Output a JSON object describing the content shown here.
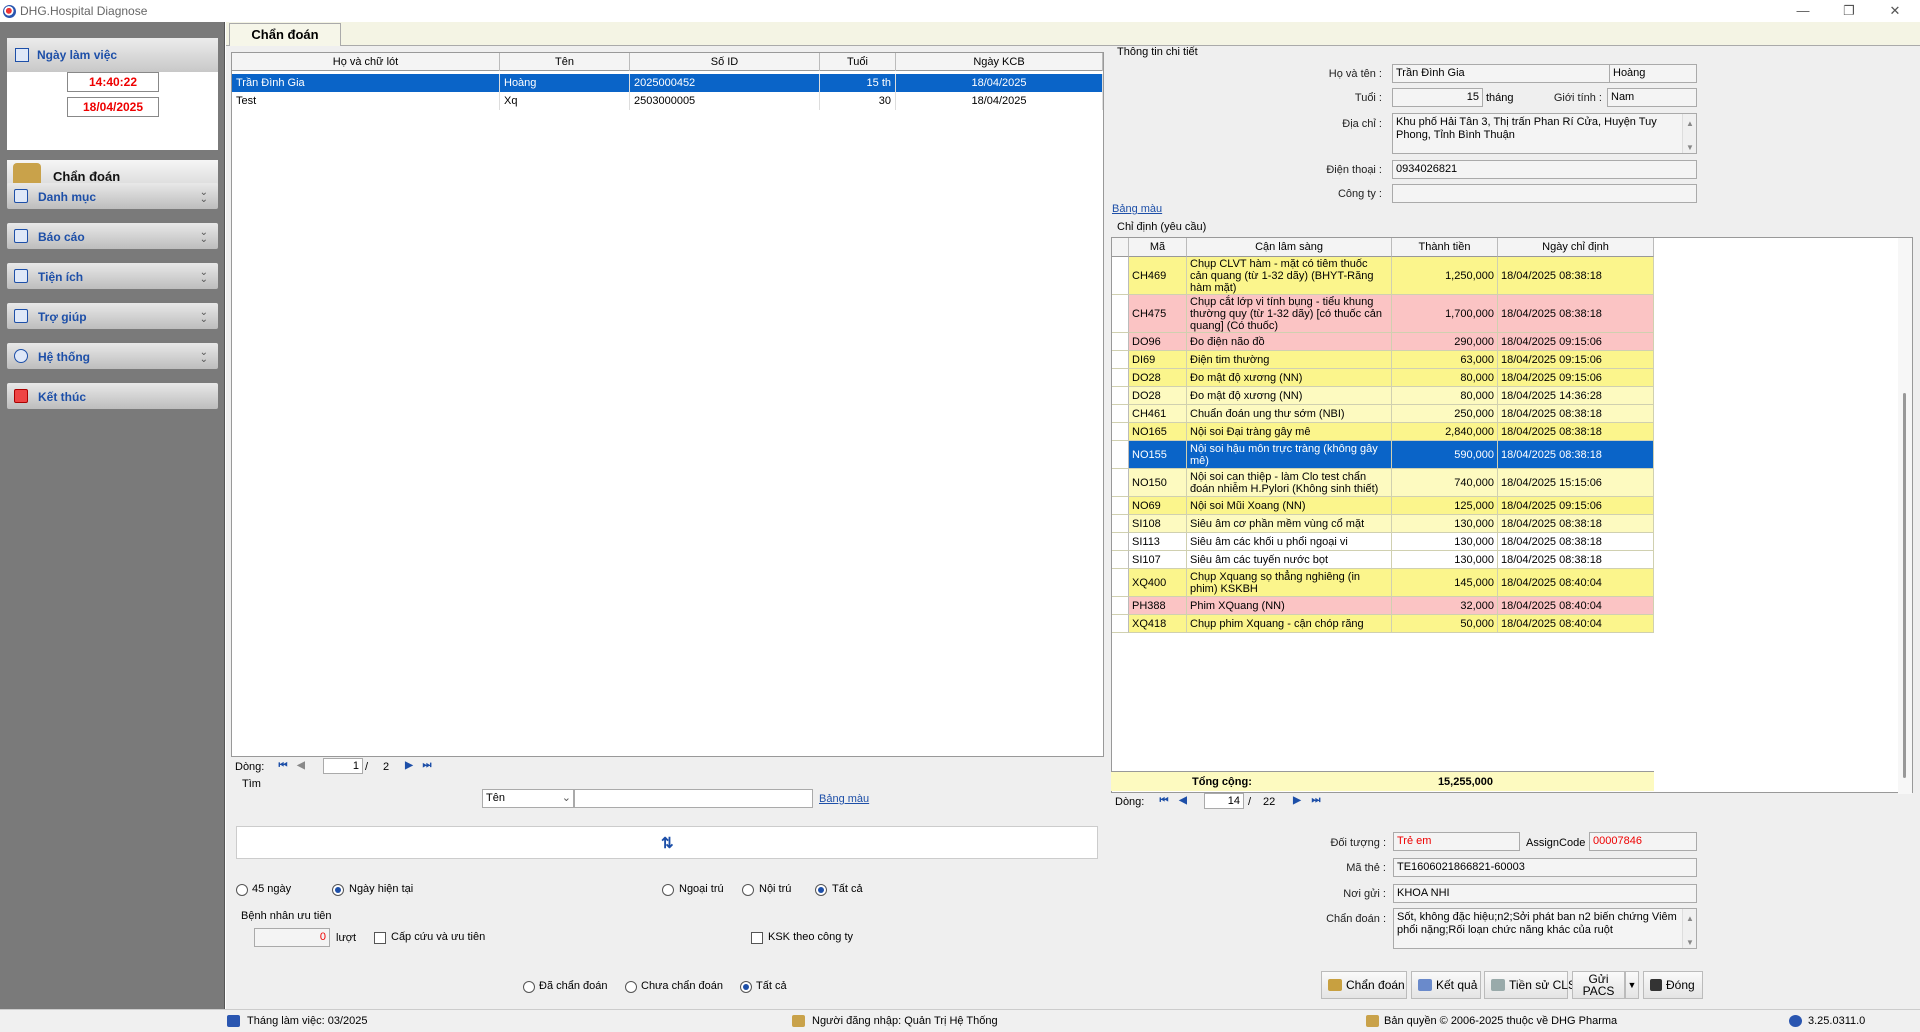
{
  "window": {
    "title": "DHG.Hospital Diagnose"
  },
  "sidebar": {
    "header": "Ngày làm việc",
    "time": "14:40:22",
    "date": "18/04/2025",
    "active": "Chẩn đoán",
    "items": [
      "Danh mục",
      "Báo cáo",
      "Tiện ích",
      "Trợ giúp",
      "Hệ thống",
      "Kết thúc"
    ]
  },
  "tab": "Chẩn đoán",
  "patients": {
    "columns": [
      "Họ và chữ lót",
      "Tên",
      "Số ID",
      "Tuổi",
      "Ngày KCB"
    ],
    "rows": [
      [
        "Trần Đình Gia",
        "Hoàng",
        "2025000452",
        "15 th",
        "18/04/2025"
      ],
      [
        "Test",
        "Xq",
        "2503000005",
        "30",
        "18/04/2025"
      ]
    ],
    "pager": {
      "label": "Dòng:",
      "current": "1",
      "total": "2"
    }
  },
  "search": {
    "label": "Tìm",
    "field": "Tên",
    "value": "",
    "color_link": "Bảng màu"
  },
  "filters": {
    "days": "45 ngày",
    "today": "Ngày hiện tại",
    "outpatient": "Ngoại trú",
    "inpatient": "Nội trú",
    "all": "Tất cả",
    "priority_group": "Bệnh nhân ưu tiên",
    "priority_count": "0",
    "priority_unit": "lượt",
    "emergency": "Cấp cứu và ưu tiên",
    "ksk": "KSK theo công ty",
    "diagnosed": "Đã chẩn đoán",
    "not_diagnosed": "Chưa chẩn đoán",
    "all2": "Tất cả"
  },
  "detail": {
    "group": "Thông tin chi tiết",
    "name_label": "Họ và tên :",
    "last": "Trần Đình Gia",
    "first": "Hoàng",
    "age_label": "Tuổi :",
    "age": "15",
    "age_unit": "tháng",
    "gender_label": "Giới tính :",
    "gender": "Nam",
    "addr_label": "Địa chỉ :",
    "address": "Khu phố Hải Tân 3, Thị trấn Phan Rí Cửa, Huyện Tuy Phong, Tỉnh Bình Thuận",
    "phone_label": "Điện thoại :",
    "phone": "0934026821",
    "company_label": "Công ty :",
    "company": "",
    "color_link": "Bảng màu"
  },
  "orders": {
    "group": "Chỉ định (yêu cầu)",
    "columns": [
      "Mã",
      "Cận lâm sàng",
      "Thành tiền",
      "Ngày chỉ định"
    ],
    "rows": [
      {
        "code": "CH469",
        "name": "Chụp CLVT hàm - mặt có tiêm thuốc cản quang (từ 1-32 dãy) (BHYT-Răng hàm mặt)",
        "amount": "1,250,000",
        "date": "18/04/2025 08:38:18",
        "color": "y",
        "h": 38
      },
      {
        "code": "CH475",
        "name": "Chụp cắt lớp vi tính bụng - tiểu khung thường quy (từ 1-32 dãy) [có thuốc cản quang] (Có thuốc)",
        "amount": "1,700,000",
        "date": "18/04/2025 08:38:18",
        "color": "p",
        "h": 38
      },
      {
        "code": "DO96",
        "name": "Đo điện não đồ",
        "amount": "290,000",
        "date": "18/04/2025 09:15:06",
        "color": "p",
        "h": 18
      },
      {
        "code": "DI69",
        "name": "Điện tim thường",
        "amount": "63,000",
        "date": "18/04/2025 09:15:06",
        "color": "y",
        "h": 18
      },
      {
        "code": "DO28",
        "name": "Đo mật độ xương (NN)",
        "amount": "80,000",
        "date": "18/04/2025 09:15:06",
        "color": "y",
        "h": 18
      },
      {
        "code": "DO28",
        "name": "Đo mật độ xương (NN)",
        "amount": "80,000",
        "date": "18/04/2025 14:36:28",
        "color": "ly",
        "h": 18
      },
      {
        "code": "CH461",
        "name": "Chuẩn đoán ung thư sớm (NBI)",
        "amount": "250,000",
        "date": "18/04/2025 08:38:18",
        "color": "ly",
        "h": 18
      },
      {
        "code": "NO165",
        "name": "Nội soi Đại tràng gây mê",
        "amount": "2,840,000",
        "date": "18/04/2025 08:38:18",
        "color": "y",
        "h": 18
      },
      {
        "code": "NO155",
        "name": "Nội soi hậu môn trực tràng (không gây mê)",
        "amount": "590,000",
        "date": "18/04/2025 08:38:18",
        "color": "bs",
        "h": 28
      },
      {
        "code": "NO150",
        "name": "Nội soi can thiệp - làm Clo test chẩn đoán nhiễm H.Pylori (Không sinh thiết)",
        "amount": "740,000",
        "date": "18/04/2025 15:15:06",
        "color": "ly",
        "h": 28
      },
      {
        "code": "NO69",
        "name": "Nội soi Mũi Xoang (NN)",
        "amount": "125,000",
        "date": "18/04/2025 09:15:06",
        "color": "y",
        "h": 18
      },
      {
        "code": "SI108",
        "name": "Siêu âm cơ phần mềm vùng cổ mặt",
        "amount": "130,000",
        "date": "18/04/2025 08:38:18",
        "color": "ly",
        "h": 18
      },
      {
        "code": "SI113",
        "name": "Siêu âm các khối u phổi ngoại vi",
        "amount": "130,000",
        "date": "18/04/2025 08:38:18",
        "color": "w",
        "h": 18
      },
      {
        "code": "SI107",
        "name": "Siêu âm các tuyến nước bọt",
        "amount": "130,000",
        "date": "18/04/2025 08:38:18",
        "color": "w",
        "h": 18
      },
      {
        "code": "XQ400",
        "name": "Chụp Xquang sọ thẳng nghiêng (in phim) KSKBH",
        "amount": "145,000",
        "date": "18/04/2025 08:40:04",
        "color": "y",
        "h": 28
      },
      {
        "code": "PH388",
        "name": "Phim XQuang (NN)",
        "amount": "32,000",
        "date": "18/04/2025 08:40:04",
        "color": "p",
        "h": 18
      },
      {
        "code": "XQ418",
        "name": "Chụp phim Xquang - cận chóp răng",
        "amount": "50,000",
        "date": "18/04/2025 08:40:04",
        "color": "y",
        "h": 18
      }
    ],
    "total_label": "Tổng cộng:",
    "total": "15,255,000",
    "pager": {
      "label": "Dòng:",
      "current": "14",
      "total": "22"
    }
  },
  "extra": {
    "subject_label": "Đối tượng :",
    "subject": "Trẻ em",
    "assign_label": "AssignCode",
    "assign": "00007846",
    "card_label": "Mã thẻ :",
    "card": "TE1606021866821-60003",
    "send_label": "Nơi gửi :",
    "send": "KHOA NHI",
    "diag_label": "Chẩn đoán :",
    "diagnosis": "Sốt, không đặc hiệu;n2;Sởi phát ban n2 biến chứng Viêm phổi nặng;Rối loạn chức năng khác của ruột"
  },
  "buttons": {
    "diagnose": "Chẩn đoán",
    "result": "Kết quả",
    "history": "Tiền sử CLS",
    "pacs": "Gửi PACS",
    "close": "Đóng"
  },
  "status": {
    "month": "Tháng làm việc: 03/2025",
    "user": "Người đăng nhập: Quản Trị Hệ Thống",
    "copyright": "Bản quyền © 2006-2025 thuộc về DHG Pharma",
    "version": "3.25.0311.0"
  }
}
